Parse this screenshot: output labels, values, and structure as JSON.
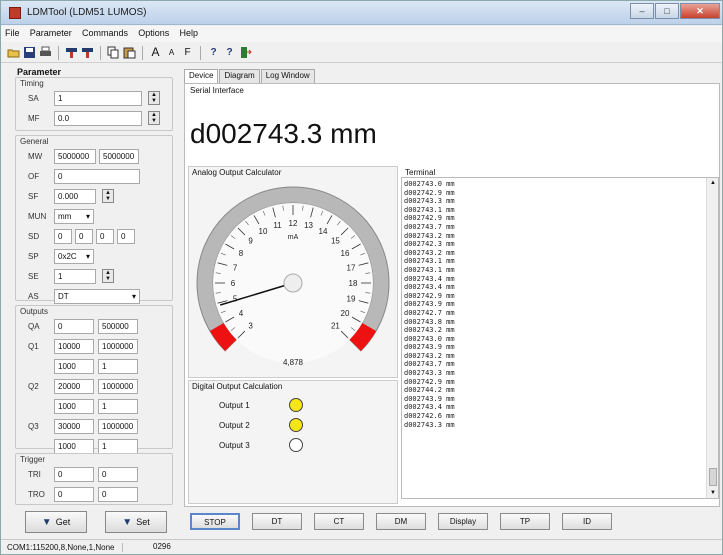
{
  "window": {
    "title": "LDMTool (LDM51 LUMOS)",
    "min": "–",
    "max": "□",
    "close": "✕"
  },
  "menu": [
    "File",
    "Parameter",
    "Commands",
    "Options",
    "Help"
  ],
  "toolbar_icons": [
    "open-icon",
    "save-icon",
    "print-icon",
    "get-icon",
    "set-icon",
    "copy-icon",
    "paste-icon",
    "font-larger-icon",
    "font-smaller-icon",
    "font-icon",
    "help-icon",
    "context-help-icon",
    "exit-icon"
  ],
  "toolbar_glyphs": {
    "font_large": "A",
    "font_small": "A",
    "font": "F",
    "help": "?",
    "context_help": "?"
  },
  "parameter": {
    "title": "Parameter",
    "timing": {
      "label": "Timing",
      "sa_label": "SA",
      "sa": "1",
      "mf_label": "MF",
      "mf": "0.0"
    },
    "general": {
      "label": "General",
      "mw_label": "MW",
      "mw1": "5000000",
      "mw2": "5000000",
      "of_label": "OF",
      "of": "0",
      "sf_label": "SF",
      "sf": "0.000",
      "mun_label": "MUN",
      "mun": "mm",
      "sd_label": "SD",
      "sd": [
        "0",
        "0",
        "0",
        "0"
      ],
      "sp_label": "SP",
      "sp": "0x2C",
      "se_label": "SE",
      "se": "1",
      "as_label": "AS",
      "as": "DT"
    },
    "outputs": {
      "label": "Outputs",
      "qa_label": "QA",
      "qa1": "0",
      "qa2": "500000",
      "q1_label": "Q1",
      "q1": [
        "10000",
        "1000000",
        "1000",
        "1"
      ],
      "q2_label": "Q2",
      "q2": [
        "20000",
        "1000000",
        "1000",
        "1"
      ],
      "q3_label": "Q3",
      "q3": [
        "30000",
        "1000000",
        "1000",
        "1"
      ]
    },
    "trigger": {
      "label": "Trigger",
      "tri_label": "TRI",
      "tri1": "0",
      "tri2": "0",
      "tro_label": "TRO",
      "tro1": "0",
      "tro2": "0"
    },
    "get_label": "Get",
    "set_label": "Set"
  },
  "tabs": [
    "Device",
    "Diagram",
    "Log Window"
  ],
  "device": {
    "serial_label": "Serial Interface",
    "reading": "d002743.3 mm",
    "aoc_label": "Analog Output Calculator",
    "gauge": {
      "unit": "mA",
      "ticks": [
        "3",
        "4",
        "5",
        "6",
        "7",
        "8",
        "9",
        "10",
        "11",
        "12",
        "13",
        "14",
        "15",
        "16",
        "17",
        "18",
        "19",
        "20",
        "21"
      ],
      "value": "4,878",
      "needle_ma": 4.878,
      "min_ma": 3,
      "max_ma": 21
    },
    "doc_label": "Digital Output Calculation",
    "outputs": [
      {
        "label": "Output 1",
        "color": "#f5e616"
      },
      {
        "label": "Output 2",
        "color": "#f5e616"
      },
      {
        "label": "Output 3",
        "color": "#ffffff"
      }
    ],
    "terminal_label": "Terminal",
    "terminal_lines": [
      "d002743.0 mm",
      "d002742.9 mm",
      "d002743.3 mm",
      "d002743.1 mm",
      "d002742.9 mm",
      "d002743.7 mm",
      "d002743.2 mm",
      "d002742.3 mm",
      "d002743.2 mm",
      "d002743.1 mm",
      "d002743.1 mm",
      "d002743.4 mm",
      "d002743.4 mm",
      "d002742.9 mm",
      "d002743.9 mm",
      "d002742.7 mm",
      "d002743.8 mm",
      "d002743.2 mm",
      "d002743.0 mm",
      "d002743.9 mm",
      "d002743.2 mm",
      "d002743.7 mm",
      "d002743.3 mm",
      "d002742.9 mm",
      "d002744.2 mm",
      "d002743.9 mm",
      "d002743.4 mm",
      "d002742.6 mm",
      "d002743.3 mm"
    ]
  },
  "bottom_buttons": [
    "STOP",
    "DT",
    "CT",
    "DM",
    "Display",
    "TP",
    "ID"
  ],
  "status": {
    "port": "COM1:115200,8,None,1,None",
    "code": "0296"
  }
}
